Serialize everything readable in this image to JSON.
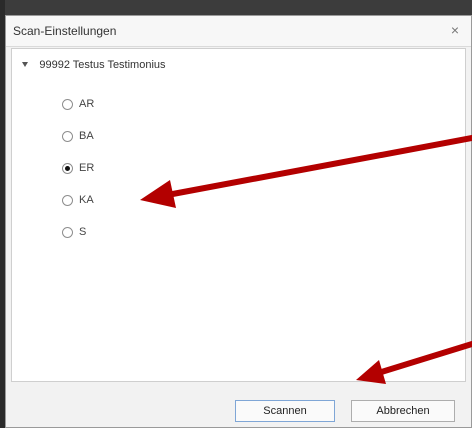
{
  "dialog": {
    "title": "Scan-Einstellungen",
    "close_glyph": "×"
  },
  "tree": {
    "root_label": "99992 Testus Testimonius",
    "options": [
      {
        "label": "AR",
        "checked": false
      },
      {
        "label": "BA",
        "checked": false
      },
      {
        "label": "ER",
        "checked": true
      },
      {
        "label": "KA",
        "checked": false
      },
      {
        "label": "S",
        "checked": false
      }
    ]
  },
  "buttons": {
    "scan_label": "Scannen",
    "cancel_label": "Abbrechen"
  },
  "colors": {
    "annotation_arrow": "#b30000",
    "primary_border": "#7fa6d6"
  },
  "icons": {
    "close": "close-icon",
    "expand": "tree-expand-icon",
    "arrow": "annotation-arrow"
  }
}
